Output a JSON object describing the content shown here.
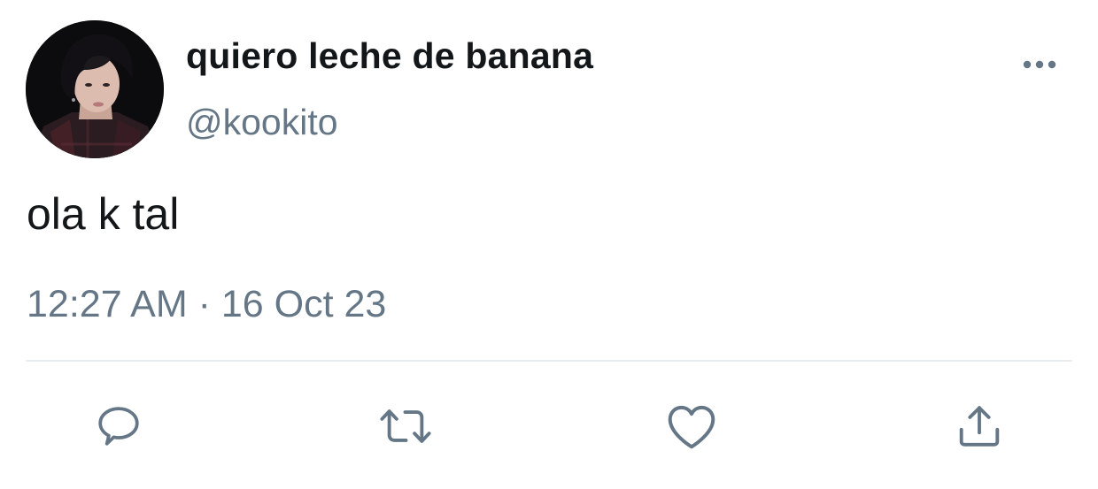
{
  "tweet": {
    "display_name": "quiero leche de banana",
    "handle": "@kookito",
    "text": "ola k tal",
    "timestamp": "12:27 AM · 16 Oct 23"
  },
  "icons": {
    "more": "more-options-icon",
    "reply": "reply-icon",
    "retweet": "retweet-icon",
    "like": "heart-icon",
    "share": "share-icon"
  },
  "colors": {
    "primary_text": "#14171a",
    "secondary_text": "#657786",
    "icon": "#657786",
    "divider": "#e6ecf0"
  }
}
